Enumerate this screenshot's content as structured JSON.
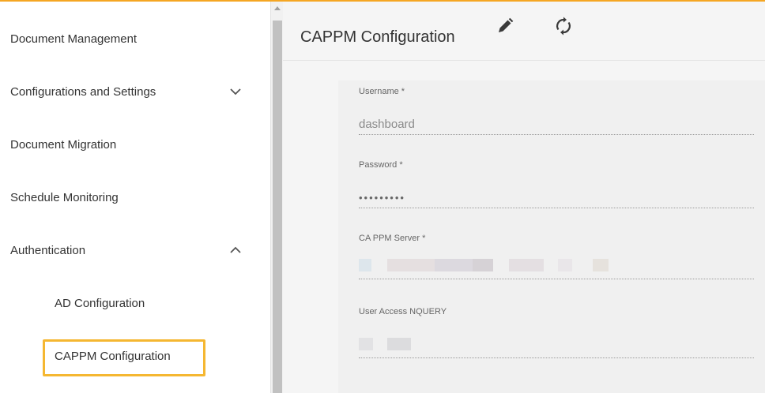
{
  "sidebar": {
    "items": [
      {
        "label": "Document Management"
      },
      {
        "label": "Configurations and Settings",
        "chevron": "chevron-down"
      },
      {
        "label": "Document Migration"
      },
      {
        "label": "Schedule Monitoring"
      },
      {
        "label": "Authentication",
        "chevron": "chevron-up"
      },
      {
        "label": "AD Configuration"
      },
      {
        "label": "CAPPM Configuration",
        "selected": true
      }
    ]
  },
  "header": {
    "title": "CAPPM Configuration",
    "edit_icon": "pencil-icon",
    "refresh_icon": "sync-icon"
  },
  "form": {
    "username": {
      "label": "Username *",
      "value": "dashboard"
    },
    "password": {
      "label": "Password *",
      "value": "•••••••••"
    },
    "server": {
      "label": "CA PPM Server *"
    },
    "nquery": {
      "label": "User Access NQUERY"
    }
  },
  "colors": {
    "accent": "#f5a623",
    "highlight": "#f5b731",
    "main_bg": "#f5f5f5"
  }
}
